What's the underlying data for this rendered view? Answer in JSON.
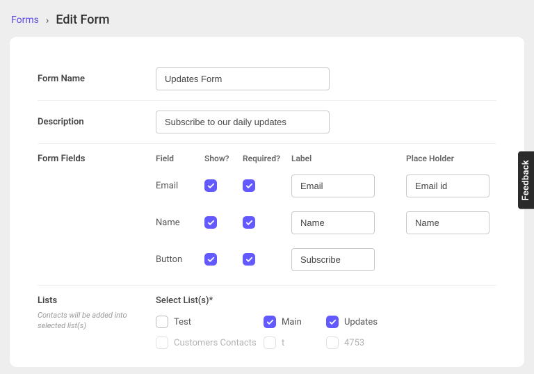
{
  "breadcrumb": {
    "root": "Forms",
    "current": "Edit Form"
  },
  "formName": {
    "label": "Form Name",
    "value": "Updates Form"
  },
  "description": {
    "label": "Description",
    "value": "Subscribe to our daily updates"
  },
  "formFields": {
    "label": "Form Fields",
    "headers": {
      "field": "Field",
      "show": "Show?",
      "required": "Required?",
      "label": "Label",
      "placeholder": "Place Holder"
    },
    "rows": [
      {
        "field": "Email",
        "show": true,
        "required": true,
        "label": "Email",
        "placeholder": "Email id"
      },
      {
        "field": "Name",
        "show": true,
        "required": true,
        "label": "Name",
        "placeholder": "Name"
      },
      {
        "field": "Button",
        "show": true,
        "required": true,
        "label": "Subscribe",
        "placeholder": null
      }
    ]
  },
  "lists": {
    "label": "Lists",
    "hint": "Contacts will be added into selected list(s)",
    "selectLabel": "Select List(s)*",
    "row1": [
      {
        "name": "Test",
        "checked": false
      },
      {
        "name": "Main",
        "checked": true
      },
      {
        "name": "Updates",
        "checked": true
      }
    ],
    "row2": [
      {
        "name": "Customers Contacts",
        "checked": false
      },
      {
        "name": "t",
        "checked": false
      },
      {
        "name": "4753",
        "checked": false
      }
    ]
  },
  "feedback": "Feedback"
}
